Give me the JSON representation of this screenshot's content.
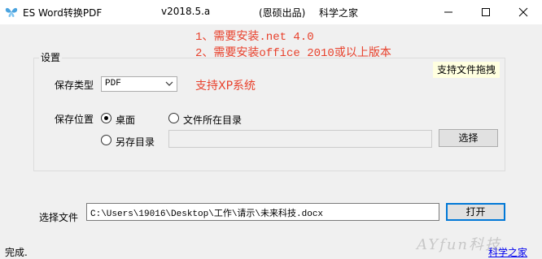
{
  "window": {
    "title": "ES Word转换PDF",
    "version": "v2018.5.a",
    "credit": "(恩硕出品)",
    "org": "科学之家",
    "controls": [
      "minimize-icon",
      "maximize-icon",
      "close-icon"
    ]
  },
  "notes": {
    "line1": "1、需要安装.net 4.0",
    "line2": "2、需要安装office 2010或以上版本",
    "xp_support": "支持XP系统",
    "color": "#e8412c"
  },
  "settings": {
    "group_title": "设置",
    "drag_hint": "支持文件拖拽",
    "save_type_label": "保存类型",
    "save_type_value": "PDF",
    "save_location_label": "保存位置",
    "option_desktop": "桌面",
    "option_file_dir": "文件所在目录",
    "option_other_dir": "另存目录",
    "other_dir_value": "",
    "choose_button": "选择",
    "selected_option": "桌面"
  },
  "file": {
    "label": "选择文件",
    "path": "C:\\Users\\19016\\Desktop\\工作\\请示\\未来科技.docx",
    "open_button": "打开"
  },
  "status": {
    "text": "完成.",
    "link": "科学之家"
  },
  "watermark": "AYfun科技"
}
